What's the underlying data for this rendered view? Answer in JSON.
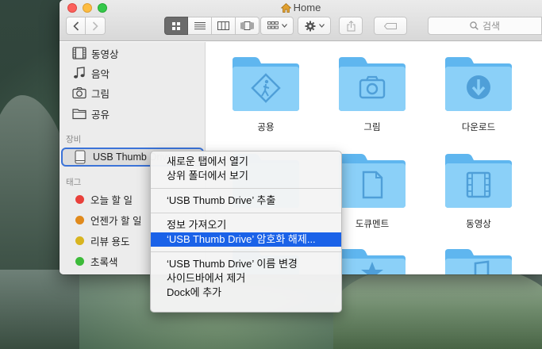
{
  "window": {
    "title": "Home"
  },
  "toolbar": {
    "back_label": "‹",
    "forward_label": "›",
    "search_placeholder": "검색"
  },
  "sidebar": {
    "favorites": [
      {
        "label": "동영상",
        "icon": "film-icon"
      },
      {
        "label": "음악",
        "icon": "music-note-icon"
      },
      {
        "label": "그림",
        "icon": "camera-icon"
      },
      {
        "label": "공유",
        "icon": "folder-icon"
      }
    ],
    "devices_header": "장비",
    "device_label": "USB Thumb Drive",
    "tags_header": "태그",
    "tags": [
      {
        "label": "오늘 할 일",
        "color": "#e9403b"
      },
      {
        "label": "언젠가 할 일",
        "color": "#e08a1c"
      },
      {
        "label": "리뷰 용도",
        "color": "#d8b420"
      },
      {
        "label": "초록색",
        "color": "#3dbb3a"
      }
    ]
  },
  "folders": [
    {
      "label": "공용",
      "icon": "public-folder-icon"
    },
    {
      "label": "그림",
      "icon": "pictures-folder-icon"
    },
    {
      "label": "다운로드",
      "icon": "downloads-folder-icon"
    },
    {
      "label": "",
      "icon": "folder-icon"
    },
    {
      "label": "도큐멘트",
      "icon": "documents-folder-icon"
    },
    {
      "label": "동영상",
      "icon": "movies-folder-icon"
    },
    {
      "label": "",
      "icon": "folder-icon"
    },
    {
      "label": "",
      "icon": "applications-folder-icon"
    },
    {
      "label": "",
      "icon": "music-folder-icon"
    }
  ],
  "context_menu": {
    "items": [
      "새로운 탭에서 열기",
      "상위 폴더에서 보기",
      "‘USB Thumb Drive’ 추출",
      "정보 가져오기",
      "‘USB Thumb Drive’ 암호화 해제...",
      "‘USB Thumb Drive’ 이름 변경",
      "사이드바에서 제거",
      "Dock에 추가"
    ],
    "highlighted_index": 4
  },
  "colors": {
    "accent": "#1a62e8",
    "folder_blue": "#73c3f4"
  }
}
